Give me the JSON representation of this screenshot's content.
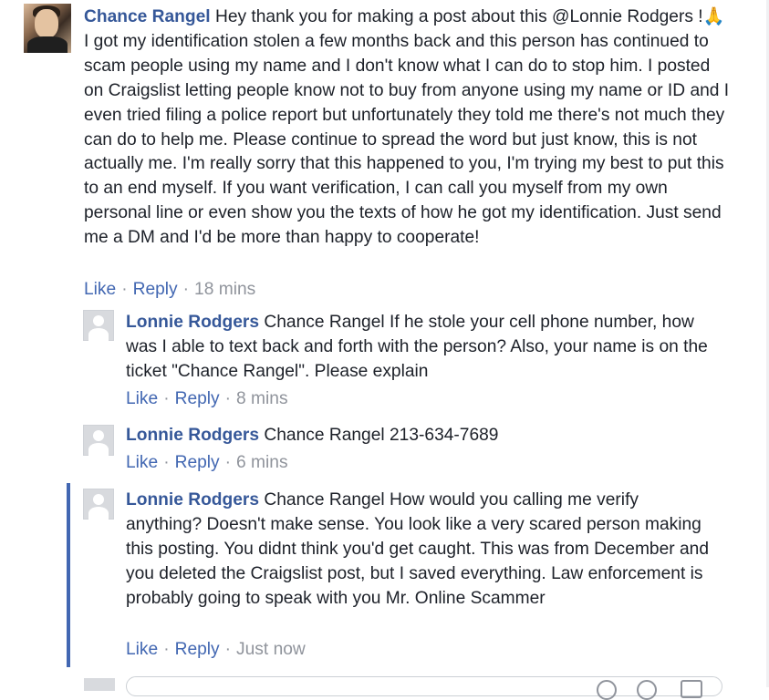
{
  "main_comment": {
    "author": "Chance Rangel",
    "text": "Hey thank you for making a post about this @Lonnie Rodgers !🙏 I got my identification stolen a few months back and this person has continued to scam people using my name and I don't know what I can do to stop him. I posted on Craigslist letting people know not to buy from anyone using my name or ID and I even tried filing a police report but unfortunately they told me there's not much they can do to help me. Please continue to spread the word but just know, this is not actually me. I'm really sorry that this happened to you, I'm trying my best to put this to an end myself. If you want verification, I can call you myself from my own personal line or even show you the texts of how he got my identification. Just send me a DM and I'd be more than happy to cooperate!",
    "like_label": "Like",
    "reply_label": "Reply",
    "time": "18 mins"
  },
  "replies": [
    {
      "author": "Lonnie Rodgers",
      "text": "Chance Rangel If he stole your cell phone number, how was I able to text back and forth with the person? Also, your name is on the ticket \"Chance Rangel\". Please explain",
      "like_label": "Like",
      "reply_label": "Reply",
      "time": "8 mins"
    },
    {
      "author": "Lonnie Rodgers",
      "text": "Chance Rangel 213-634-7689",
      "like_label": "Like",
      "reply_label": "Reply",
      "time": "6 mins"
    },
    {
      "author": "Lonnie Rodgers",
      "text": "Chance Rangel How would you calling me verify anything? Doesn't make sense. You look like a very scared person making this posting. You didnt think you'd get caught. This was from December and you deleted the Craigslist post, but I saved everything. Law enforcement is probably going to speak with you Mr. Online Scammer",
      "like_label": "Like",
      "reply_label": "Reply",
      "time": "Just now"
    }
  ],
  "colors": {
    "author": "#365899",
    "action_link": "#4267b2",
    "meta": "#90949c",
    "highlight": "#4267b2"
  }
}
